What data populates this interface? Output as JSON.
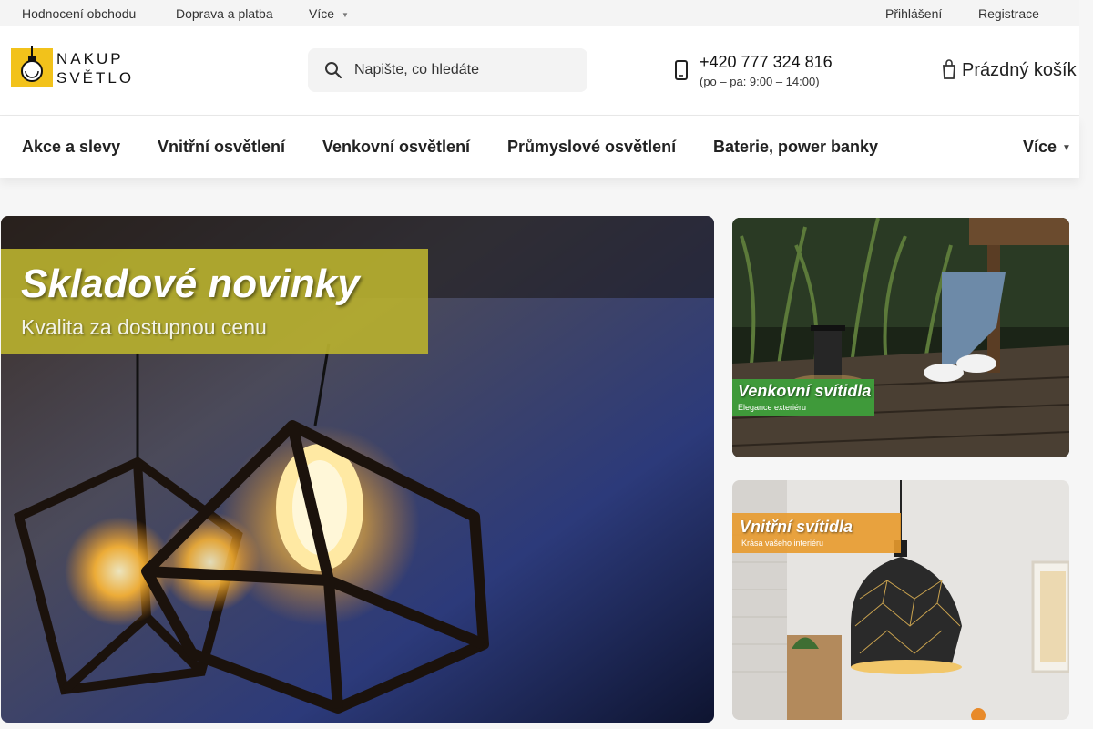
{
  "topbar": {
    "links": [
      "Hodnocení obchodu",
      "Doprava a platba",
      "Více"
    ],
    "login": "Přihlášení",
    "register": "Registrace"
  },
  "header": {
    "logo_line1": "NAKUP",
    "logo_line2": "SVĚTLO",
    "search_placeholder": "Napište, co hledáte",
    "phone": "+420 777 324 816",
    "phone_hours": "(po – pa: 9:00 – 14:00)",
    "cart": "Prázdný košík"
  },
  "nav": {
    "items": [
      "Akce a slevy",
      "Vnitřní osvětlení",
      "Venkovní osvětlení",
      "Průmyslové osvětlení",
      "Baterie, power banky"
    ],
    "more": "Více"
  },
  "banners": {
    "main": {
      "title": "Skladové novinky",
      "subtitle": "Kvalita za dostupnou cenu"
    },
    "outdoor": {
      "title": "Venkovní svítidla",
      "subtitle": "Elegance exteriéru"
    },
    "indoor": {
      "title": "Vnitřní svítidla",
      "subtitle": "Krása vašeho interiéru"
    }
  },
  "colors": {
    "accent_yellow": "#f2c21b",
    "banner_olive": "#b7b02f",
    "banner_green": "#3f9a3a",
    "banner_orange": "#e89a2c"
  },
  "icons": {
    "search": "search-icon",
    "phone": "phone-icon",
    "cart": "cart-icon",
    "caret": "chevron-down-icon"
  }
}
